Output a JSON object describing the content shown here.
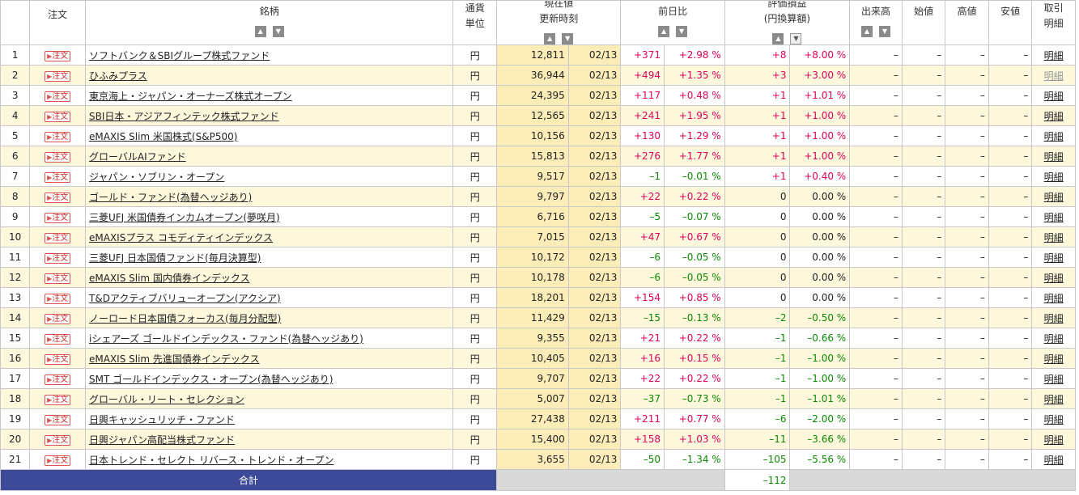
{
  "headers": {
    "order": "注文",
    "name": "銘柄",
    "currency_line1": "通貨",
    "currency_line2": "単位",
    "price_line1": "現在値",
    "price_line2": "更新時刻",
    "change": "前日比",
    "pl_line1": "評価損益",
    "pl_line2": "(円換算額)",
    "volume": "出来高",
    "open": "始値",
    "high": "高値",
    "low": "安値",
    "detail_line1": "取引",
    "detail_line2": "明細"
  },
  "sort_icons": {
    "up": "▲",
    "down": "▼"
  },
  "order_button_label": "注文",
  "order_button_icon": "▶",
  "rows": [
    {
      "no": "1",
      "name": "ソフトバンク＆SBIグループ株式ファンド",
      "currency": "円",
      "price": "12,811",
      "time": "02/13",
      "chg": "+371",
      "chg_pct": "+2.98 %",
      "pl": "+8",
      "pl_pct": "+8.00 %",
      "vol": "–",
      "open": "–",
      "high": "–",
      "low": "–",
      "detail": "明細"
    },
    {
      "no": "2",
      "name": "ひふみプラス",
      "currency": "円",
      "price": "36,944",
      "time": "02/13",
      "chg": "+494",
      "chg_pct": "+1.35 %",
      "pl": "+3",
      "pl_pct": "+3.00 %",
      "vol": "–",
      "open": "–",
      "high": "–",
      "low": "–",
      "detail": "明細"
    },
    {
      "no": "3",
      "name": "東京海上・ジャパン・オーナーズ株式オープン",
      "currency": "円",
      "price": "24,395",
      "time": "02/13",
      "chg": "+117",
      "chg_pct": "+0.48 %",
      "pl": "+1",
      "pl_pct": "+1.01 %",
      "vol": "–",
      "open": "–",
      "high": "–",
      "low": "–",
      "detail": "明細"
    },
    {
      "no": "4",
      "name": "SBI日本・アジアフィンテック株式ファンド",
      "currency": "円",
      "price": "12,565",
      "time": "02/13",
      "chg": "+241",
      "chg_pct": "+1.95 %",
      "pl": "+1",
      "pl_pct": "+1.00 %",
      "vol": "–",
      "open": "–",
      "high": "–",
      "low": "–",
      "detail": "明細"
    },
    {
      "no": "5",
      "name": "eMAXIS Slim 米国株式(S&P500)",
      "currency": "円",
      "price": "10,156",
      "time": "02/13",
      "chg": "+130",
      "chg_pct": "+1.29 %",
      "pl": "+1",
      "pl_pct": "+1.00 %",
      "vol": "–",
      "open": "–",
      "high": "–",
      "low": "–",
      "detail": "明細"
    },
    {
      "no": "6",
      "name": "グローバルAIファンド",
      "currency": "円",
      "price": "15,813",
      "time": "02/13",
      "chg": "+276",
      "chg_pct": "+1.77 %",
      "pl": "+1",
      "pl_pct": "+1.00 %",
      "vol": "–",
      "open": "–",
      "high": "–",
      "low": "–",
      "detail": "明細"
    },
    {
      "no": "7",
      "name": "ジャパン・ソブリン・オープン",
      "currency": "円",
      "price": "9,517",
      "time": "02/13",
      "chg": "–1",
      "chg_pct": "–0.01 %",
      "pl": "+1",
      "pl_pct": "+0.40 %",
      "vol": "–",
      "open": "–",
      "high": "–",
      "low": "–",
      "detail": "明細"
    },
    {
      "no": "8",
      "name": "ゴールド・ファンド(為替ヘッジあり)",
      "currency": "円",
      "price": "9,797",
      "time": "02/13",
      "chg": "+22",
      "chg_pct": "+0.22 %",
      "pl": "0",
      "pl_pct": "0.00 %",
      "vol": "–",
      "open": "–",
      "high": "–",
      "low": "–",
      "detail": "明細"
    },
    {
      "no": "9",
      "name": "三菱UFJ 米国債券インカムオープン(夢咲月)",
      "currency": "円",
      "price": "6,716",
      "time": "02/13",
      "chg": "–5",
      "chg_pct": "–0.07 %",
      "pl": "0",
      "pl_pct": "0.00 %",
      "vol": "–",
      "open": "–",
      "high": "–",
      "low": "–",
      "detail": "明細"
    },
    {
      "no": "10",
      "name": "eMAXISプラス コモディティインデックス",
      "currency": "円",
      "price": "7,015",
      "time": "02/13",
      "chg": "+47",
      "chg_pct": "+0.67 %",
      "pl": "0",
      "pl_pct": "0.00 %",
      "vol": "–",
      "open": "–",
      "high": "–",
      "low": "–",
      "detail": "明細"
    },
    {
      "no": "11",
      "name": "三菱UFJ 日本国債ファンド(毎月決算型)",
      "currency": "円",
      "price": "10,172",
      "time": "02/13",
      "chg": "–6",
      "chg_pct": "–0.05 %",
      "pl": "0",
      "pl_pct": "0.00 %",
      "vol": "–",
      "open": "–",
      "high": "–",
      "low": "–",
      "detail": "明細"
    },
    {
      "no": "12",
      "name": "eMAXIS Slim 国内債券インデックス",
      "currency": "円",
      "price": "10,178",
      "time": "02/13",
      "chg": "–6",
      "chg_pct": "–0.05 %",
      "pl": "0",
      "pl_pct": "0.00 %",
      "vol": "–",
      "open": "–",
      "high": "–",
      "low": "–",
      "detail": "明細"
    },
    {
      "no": "13",
      "name": "T&Dアクティブバリューオープン(アクシア)",
      "currency": "円",
      "price": "18,201",
      "time": "02/13",
      "chg": "+154",
      "chg_pct": "+0.85 %",
      "pl": "0",
      "pl_pct": "0.00 %",
      "vol": "–",
      "open": "–",
      "high": "–",
      "low": "–",
      "detail": "明細"
    },
    {
      "no": "14",
      "name": "ノーロード日本国債フォーカス(毎月分配型)",
      "currency": "円",
      "price": "11,429",
      "time": "02/13",
      "chg": "–15",
      "chg_pct": "–0.13 %",
      "pl": "–2",
      "pl_pct": "–0.50 %",
      "vol": "–",
      "open": "–",
      "high": "–",
      "low": "–",
      "detail": "明細"
    },
    {
      "no": "15",
      "name": "iシェアーズ ゴールドインデックス・ファンド(為替ヘッジあり)",
      "currency": "円",
      "price": "9,355",
      "time": "02/13",
      "chg": "+21",
      "chg_pct": "+0.22 %",
      "pl": "–1",
      "pl_pct": "–0.66 %",
      "vol": "–",
      "open": "–",
      "high": "–",
      "low": "–",
      "detail": "明細"
    },
    {
      "no": "16",
      "name": "eMAXIS Slim 先進国債券インデックス",
      "currency": "円",
      "price": "10,405",
      "time": "02/13",
      "chg": "+16",
      "chg_pct": "+0.15 %",
      "pl": "–1",
      "pl_pct": "–1.00 %",
      "vol": "–",
      "open": "–",
      "high": "–",
      "low": "–",
      "detail": "明細"
    },
    {
      "no": "17",
      "name": "SMT ゴールドインデックス・オープン(為替ヘッジあり)",
      "currency": "円",
      "price": "9,707",
      "time": "02/13",
      "chg": "+22",
      "chg_pct": "+0.22 %",
      "pl": "–1",
      "pl_pct": "–1.00 %",
      "vol": "–",
      "open": "–",
      "high": "–",
      "low": "–",
      "detail": "明細"
    },
    {
      "no": "18",
      "name": "グローバル・リート・セレクション",
      "currency": "円",
      "price": "5,007",
      "time": "02/13",
      "chg": "–37",
      "chg_pct": "–0.73 %",
      "pl": "–1",
      "pl_pct": "–1.01 %",
      "vol": "–",
      "open": "–",
      "high": "–",
      "low": "–",
      "detail": "明細"
    },
    {
      "no": "19",
      "name": "日興キャッシュリッチ・ファンド",
      "currency": "円",
      "price": "27,438",
      "time": "02/13",
      "chg": "+211",
      "chg_pct": "+0.77 %",
      "pl": "–6",
      "pl_pct": "–2.00 %",
      "vol": "–",
      "open": "–",
      "high": "–",
      "low": "–",
      "detail": "明細"
    },
    {
      "no": "20",
      "name": "日興ジャパン高配当株式ファンド",
      "currency": "円",
      "price": "15,400",
      "time": "02/13",
      "chg": "+158",
      "chg_pct": "+1.03 %",
      "pl": "–11",
      "pl_pct": "–3.66 %",
      "vol": "–",
      "open": "–",
      "high": "–",
      "low": "–",
      "detail": "明細"
    },
    {
      "no": "21",
      "name": "日本トレンド・セレクト リバース・トレンド・オープン",
      "currency": "円",
      "price": "3,655",
      "time": "02/13",
      "chg": "–50",
      "chg_pct": "–1.34 %",
      "pl": "–105",
      "pl_pct": "–5.56 %",
      "vol": "–",
      "open": "–",
      "high": "–",
      "low": "–",
      "detail": "明細"
    }
  ],
  "footer": {
    "label": "合計",
    "total_pl": "–112"
  },
  "colors": {
    "up": "#e0005a",
    "down": "#0a8a00",
    "total_bar": "#3d4a9a",
    "price_bg": "#fbecb8",
    "stripe": "#fdf8dc"
  }
}
